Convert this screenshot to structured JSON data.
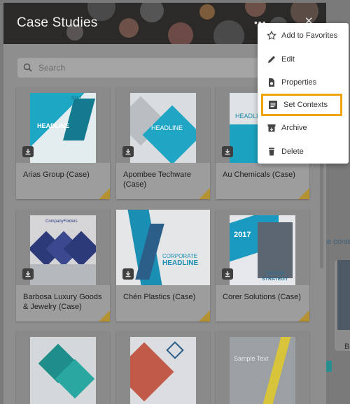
{
  "panel": {
    "title": "Case Studies",
    "search_placeholder": "Search"
  },
  "menu": {
    "items": [
      {
        "label": "Add to Favorites",
        "icon": "star-outline-icon"
      },
      {
        "label": "Edit",
        "icon": "pencil-icon"
      },
      {
        "label": "Properties",
        "icon": "file-settings-icon"
      },
      {
        "label": "Set Contexts",
        "icon": "list-icon",
        "highlighted": true
      },
      {
        "label": "Archive",
        "icon": "archive-box-icon"
      },
      {
        "label": "Delete",
        "icon": "trash-icon"
      }
    ]
  },
  "cards": [
    {
      "name": "Arias Group (Case)",
      "cover_text": [
        "2017",
        "HEADLINE"
      ]
    },
    {
      "name": "Apombee Techware (Case)",
      "cover_text": [
        "HEADLINE"
      ]
    },
    {
      "name": "Au Chemicals (Case)",
      "cover_text": [
        "HEADLINE"
      ]
    },
    {
      "name": "Barbosa Luxury Goods & Jewelry (Case)",
      "cover_text": [
        "CompanyFolders"
      ]
    },
    {
      "name": "Chén Plastics (Case)",
      "cover_text": [
        "CORPORATE",
        "HEADLINE"
      ]
    },
    {
      "name": "Corer Solutions (Case)",
      "cover_text": [
        "2017",
        "DESIGN",
        "STRATEGY"
      ]
    },
    {
      "name": "",
      "cover_text": []
    },
    {
      "name": "",
      "cover_text": []
    },
    {
      "name": "",
      "cover_text": [
        "Sample Text"
      ]
    }
  ],
  "background": {
    "link_fragment": "te conte",
    "letter": "B"
  },
  "colors": {
    "highlight_border": "#f0a30a",
    "corner_tag": "#b59231",
    "teal": "#2aa7c0"
  }
}
